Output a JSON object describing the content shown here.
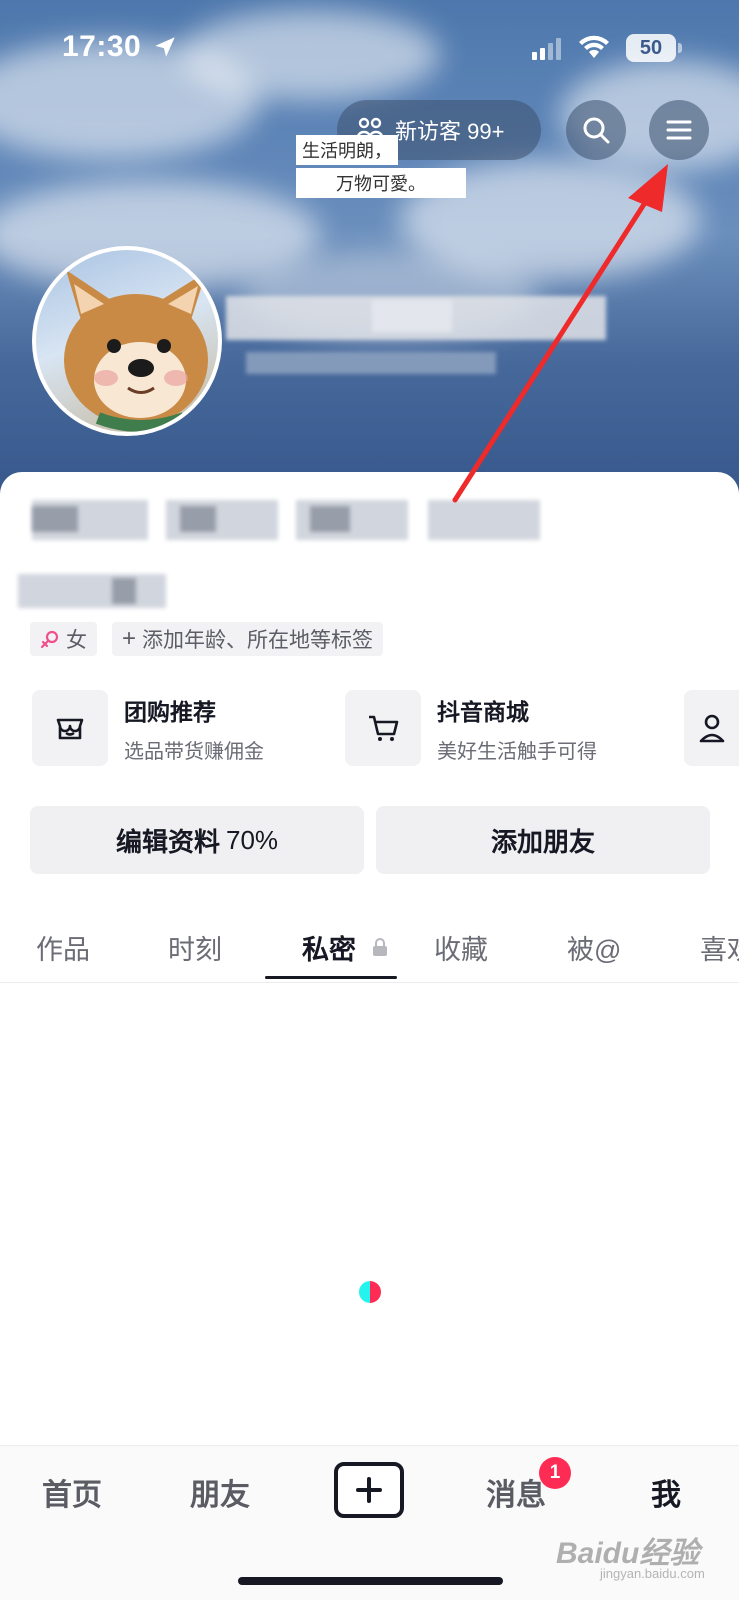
{
  "status_bar": {
    "time": "17:30",
    "battery": "50",
    "icons": [
      "location-arrow-icon",
      "cellular-signal-icon",
      "wifi-icon",
      "battery-icon"
    ]
  },
  "header": {
    "visitor_label": "新访客 99+",
    "visitor_icon": "people-icon",
    "search_icon": "search-icon",
    "menu_icon": "hamburger-menu-icon",
    "sticker_line1": "生活明朗，",
    "sticker_line2": "万物可愛。"
  },
  "profile": {
    "platform_prefix": "抖音",
    "gender_label": "女",
    "gender_icon": "female-icon",
    "add_tag_label": "添加年龄、所在地等标签"
  },
  "services": [
    {
      "title": "团购推荐",
      "subtitle": "选品带货赚佣金",
      "icon": "store-icon"
    },
    {
      "title": "抖音商城",
      "subtitle": "美好生活触手可得",
      "icon": "cart-icon"
    }
  ],
  "actions": {
    "edit_profile": "编辑资料",
    "edit_progress": "70%",
    "add_friend": "添加朋友"
  },
  "tabs": [
    {
      "label": "作品"
    },
    {
      "label": "时刻"
    },
    {
      "label": "私密"
    },
    {
      "label": "收藏"
    },
    {
      "label": "被@"
    },
    {
      "label": "喜欢"
    }
  ],
  "bottom_nav": {
    "home": "首页",
    "friends": "朋友",
    "messages": "消息",
    "messages_badge": "1",
    "me": "我"
  },
  "watermark": {
    "brand": "Baidu经验",
    "url": "jingyan.baidu.com"
  },
  "colors": {
    "accent": "#fe2c55",
    "annotation_arrow": "#ee2a2a",
    "text_primary": "#161823"
  }
}
